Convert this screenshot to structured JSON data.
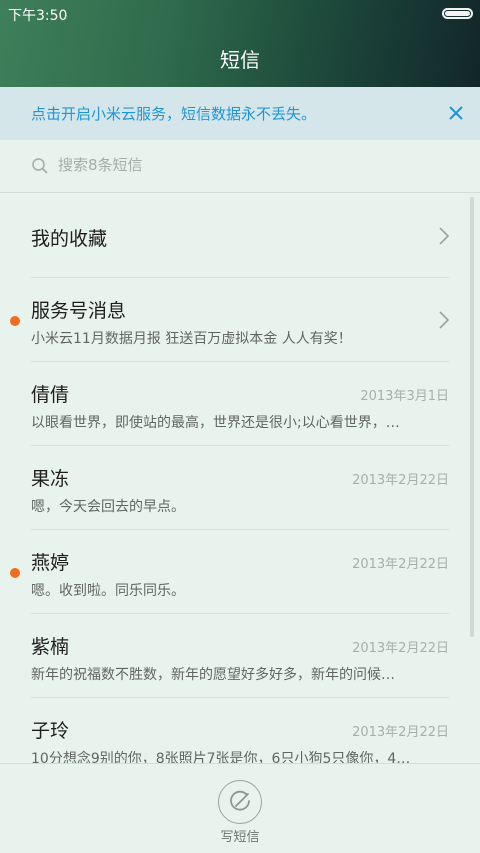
{
  "status_bar": {
    "time": "下午3:50"
  },
  "header": {
    "title": "短信"
  },
  "banner": {
    "text": "点击开启小米云服务，短信数据永不丢失。"
  },
  "search": {
    "placeholder": "搜索8条短信"
  },
  "favorites": {
    "label": "我的收藏"
  },
  "service": {
    "title": "服务号消息",
    "snippet": "小米云11月数据月报 狂送百万虚拟本金 人人有奖！",
    "unread": true
  },
  "conversations": [
    {
      "name": "倩倩",
      "date": "2013年3月1日",
      "snippet": "以眼看世界，即使站的最高，世界还是很小;以心看世界，…",
      "unread": false
    },
    {
      "name": "果冻",
      "date": "2013年2月22日",
      "snippet": "嗯，今天会回去的早点。",
      "unread": false
    },
    {
      "name": "燕婷",
      "date": "2013年2月22日",
      "snippet": "嗯。收到啦。同乐同乐。",
      "unread": true
    },
    {
      "name": "紫楠",
      "date": "2013年2月22日",
      "snippet": "新年的祝福数不胜数，新年的愿望好多好多，新年的问候…",
      "unread": false
    },
    {
      "name": "子玲",
      "date": "2013年2月22日",
      "snippet": "10分想念9别的你，8张照片7张是你，6只小狗5只像你，4…",
      "unread": false
    }
  ],
  "bottom_bar": {
    "compose_label": "写短信"
  },
  "colors": {
    "accent": "#1f95d8",
    "unread": "#f36a21",
    "background": "#e9f3ee"
  }
}
